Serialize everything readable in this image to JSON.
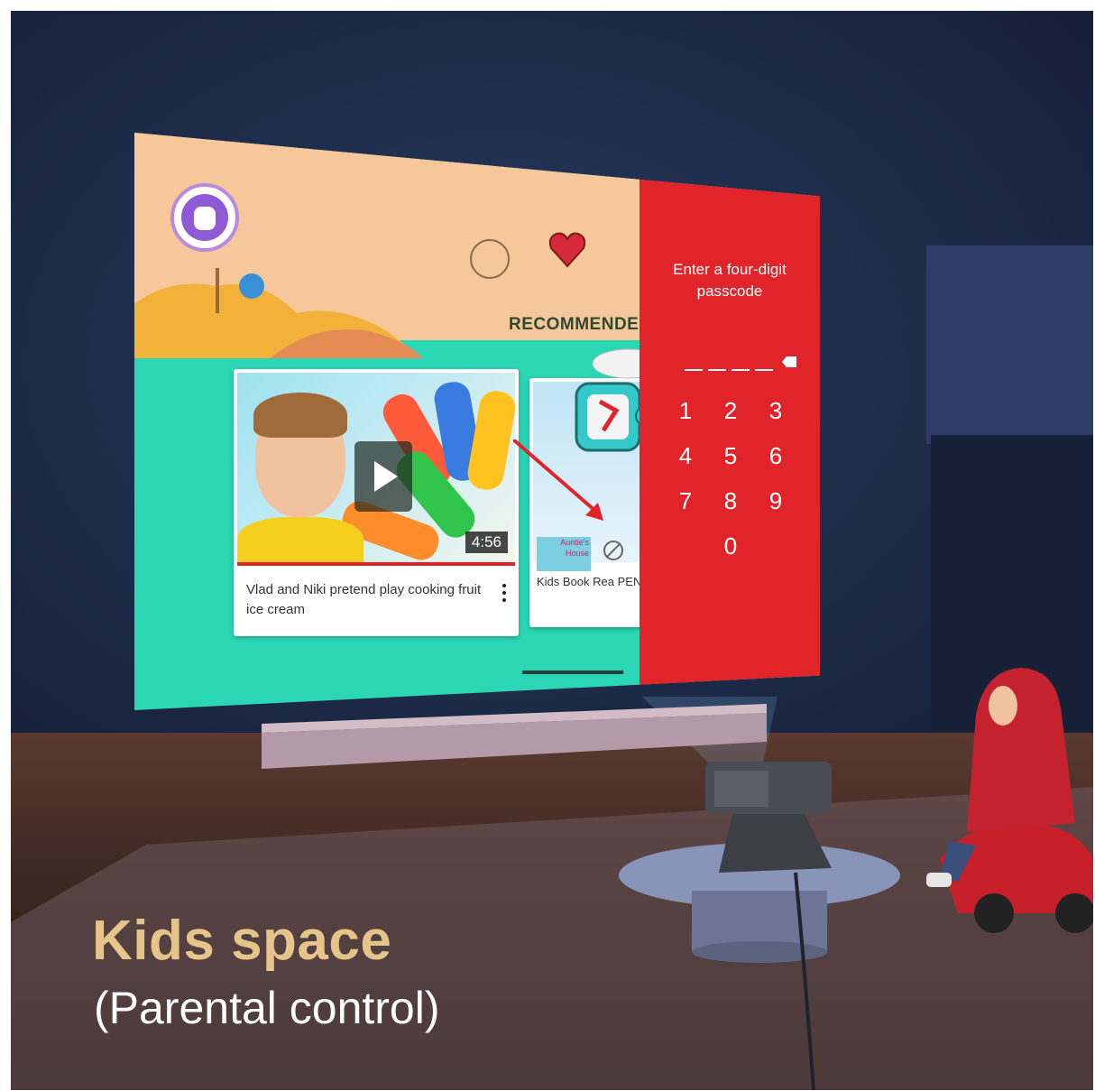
{
  "screen": {
    "section_heading": "RECOMMENDED",
    "video_card": {
      "duration": "4:56",
      "title": "Vlad and Niki pretend play cooking fruit ice cream"
    },
    "second_card": {
      "thumb_text": "Auntie's House",
      "title": "Kids Book Rea PENGUIN WITH R"
    },
    "passcode_panel": {
      "prompt": "Enter a four-digit passcode",
      "keys": [
        "1",
        "2",
        "3",
        "4",
        "5",
        "6",
        "7",
        "8",
        "9",
        "0"
      ]
    }
  },
  "caption": {
    "headline": "Kids space",
    "subheadline": "(Parental control)"
  },
  "colors": {
    "passcode_red": "#e0242a",
    "screen_teal": "#2bd6b4",
    "screen_peach": "#f6c79a",
    "headline_gold": "#e6c58a"
  }
}
